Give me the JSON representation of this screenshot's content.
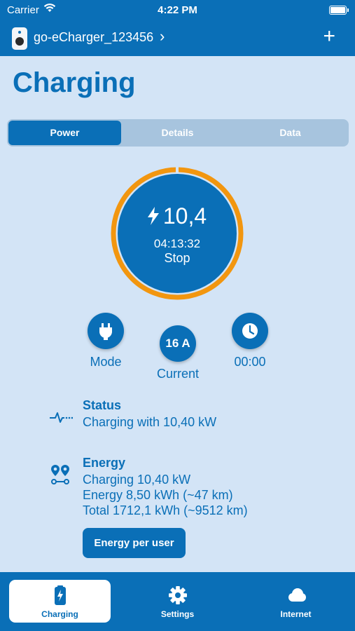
{
  "status_bar": {
    "carrier": "Carrier",
    "time": "4:22 PM"
  },
  "nav": {
    "device_name": "go-eCharger_123456",
    "chevron": "›",
    "add_icon": "+"
  },
  "page": {
    "title": "Charging"
  },
  "segments": [
    {
      "label": "Power",
      "active": true
    },
    {
      "label": "Details",
      "active": false
    },
    {
      "label": "Data",
      "active": false
    }
  ],
  "gauge": {
    "power": "10,4",
    "duration": "04:13:32",
    "action": "Stop",
    "ring_color": "#f2960f"
  },
  "controls": {
    "mode_label": "Mode",
    "current_value": "16 A",
    "current_label": "Current",
    "timer_label": "00:00"
  },
  "status": {
    "title": "Status",
    "text": "Charging with 10,40 kW"
  },
  "energy": {
    "title": "Energy",
    "lines": [
      "Charging 10,40 kW",
      "Energy 8,50 kWh (~47 km)",
      "Total 1712,1 kWh (~9512 km)"
    ],
    "button_label": "Energy per user"
  },
  "tabs": [
    {
      "label": "Charging",
      "icon": "battery-charging-icon",
      "active": true
    },
    {
      "label": "Settings",
      "icon": "gear-icon",
      "active": false
    },
    {
      "label": "Internet",
      "icon": "cloud-icon",
      "active": false
    }
  ],
  "colors": {
    "primary": "#0a6fb7",
    "background": "#d3e4f6",
    "accent": "#f2960f",
    "segment_bg": "#a7c4de"
  }
}
